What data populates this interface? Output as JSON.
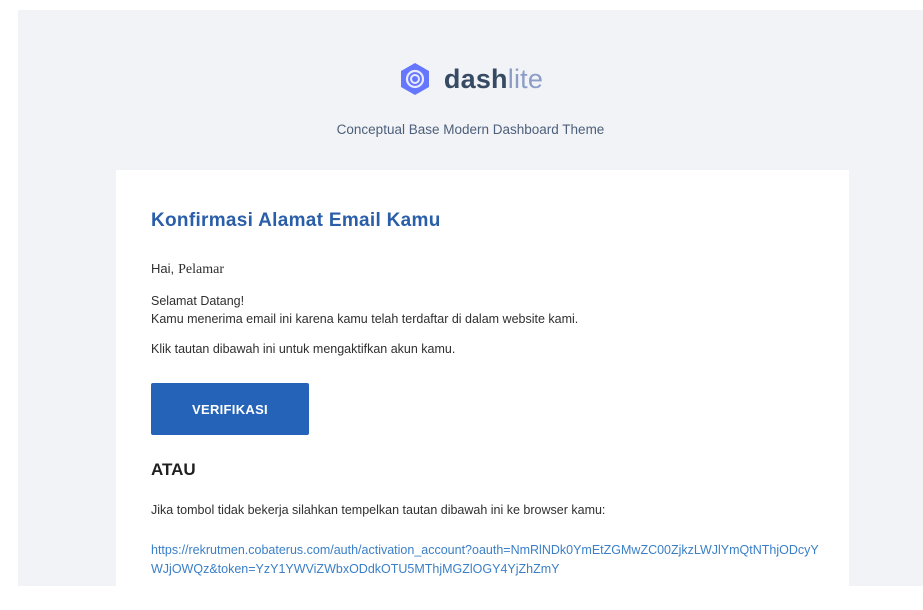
{
  "brand": {
    "name_bold": "dash",
    "name_light": "lite",
    "logo_icon": "hexagon-logo-icon",
    "tagline": "Conceptual Base Modern Dashboard Theme"
  },
  "email": {
    "heading": "Konfirmasi Alamat Email Kamu",
    "greeting": "Hai,",
    "recipient": "Pelamar",
    "welcome": "Selamat Datang!",
    "reason": "Kamu menerima email ini karena kamu telah terdaftar di dalam website kami.",
    "click_instruction": "Klik tautan dibawah ini untuk mengaktifkan akun kamu.",
    "verify_button": "VERIFIKASI",
    "or_label": "ATAU",
    "fallback_instruction": "Jika tombol tidak bekerja silahkan tempelkan tautan dibawah ini ke browser kamu:",
    "activation_link": "https://rekrutmen.cobaterus.com/auth/activation_account?oauth=NmRlNDk0YmEtZGMwZC00ZjkzLWJlYmQtNThjODcyYWJjOWQz&token=YzY1YWViZWbxODdkOTU5MThjMGZlOGY4YjZhZmY"
  },
  "colors": {
    "brand_dark": "#364a63",
    "brand_light": "#8b9dc7",
    "logo": "#6576ff",
    "heading": "#2a5ea8",
    "button": "#2563b8",
    "link": "#3a7fc7",
    "outer_bg": "#f2f3f6"
  }
}
